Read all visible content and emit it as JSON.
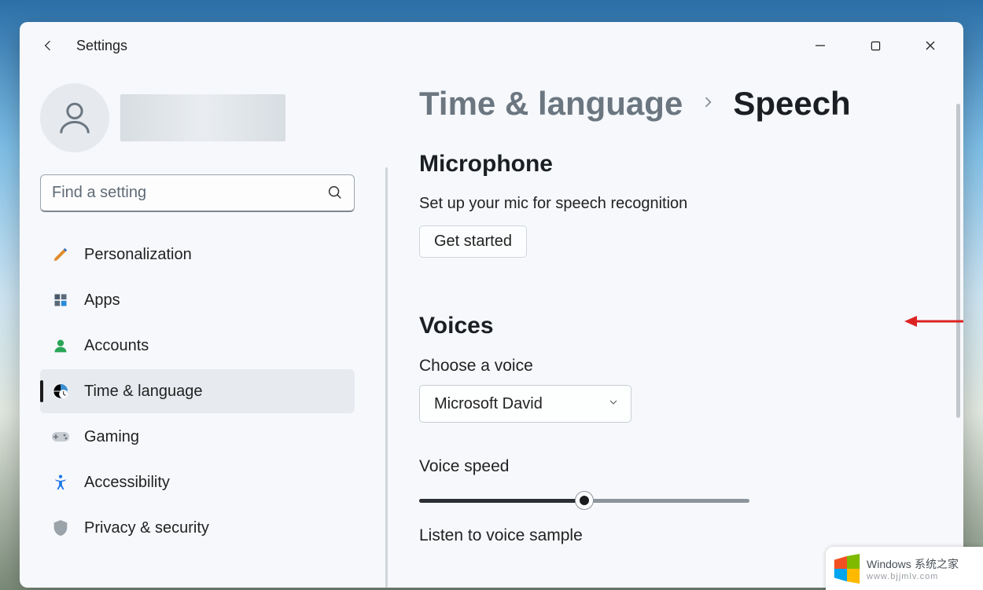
{
  "app": {
    "title": "Settings"
  },
  "search": {
    "placeholder": "Find a setting"
  },
  "sidebar": {
    "items": [
      {
        "label": "Personalization"
      },
      {
        "label": "Apps"
      },
      {
        "label": "Accounts"
      },
      {
        "label": "Time & language"
      },
      {
        "label": "Gaming"
      },
      {
        "label": "Accessibility"
      },
      {
        "label": "Privacy & security"
      }
    ]
  },
  "breadcrumb": {
    "parent": "Time & language",
    "current": "Speech"
  },
  "microphone": {
    "heading": "Microphone",
    "description": "Set up your mic for speech recognition",
    "button": "Get started"
  },
  "voices": {
    "heading": "Voices",
    "choose_label": "Choose a voice",
    "selected": "Microsoft David",
    "speed_label": "Voice speed",
    "listen_label": "Listen to voice sample"
  },
  "watermark": {
    "brand": "Windows",
    "tag": "系统之家",
    "url": "www.bjjmlv.com"
  }
}
